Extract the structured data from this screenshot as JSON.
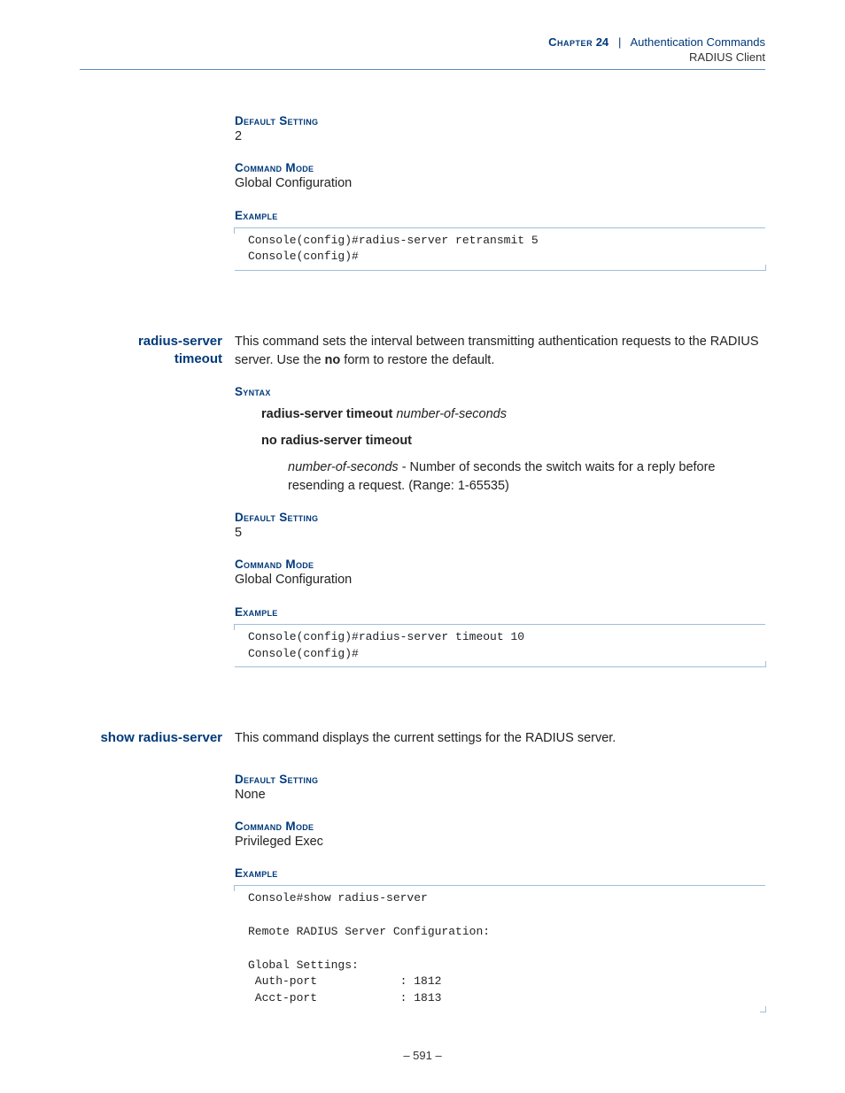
{
  "header": {
    "chapter_label": "Chapter",
    "chapter_num": "24",
    "divider": "|",
    "chapter_title": "Authentication Commands",
    "subtitle": "RADIUS Client"
  },
  "sections": {
    "prev": {
      "default_label": "Default Setting",
      "default_value": "2",
      "mode_label": "Command Mode",
      "mode_value": "Global Configuration",
      "example_label": "Example",
      "example_code": "Console(config)#radius-server retransmit 5\nConsole(config)#"
    },
    "timeout": {
      "name_line1": "radius-server",
      "name_line2": "timeout",
      "desc_prefix": "This command sets the interval between transmitting authentication requests to the RADIUS server. Use the ",
      "desc_bold": "no",
      "desc_suffix": " form to restore the default.",
      "syntax_label": "Syntax",
      "syntax1_cmd": "radius-server timeout",
      "syntax1_arg": "number-of-seconds",
      "syntax2": "no radius-server timeout",
      "param_name": "number-of-seconds",
      "param_desc": " - Number of seconds the switch waits for a reply before resending a request. (Range: 1-65535)",
      "default_label": "Default Setting",
      "default_value": "5",
      "mode_label": "Command Mode",
      "mode_value": "Global Configuration",
      "example_label": "Example",
      "example_code": "Console(config)#radius-server timeout 10\nConsole(config)#"
    },
    "show": {
      "name": "show radius-server",
      "desc": "This command displays the current settings for the RADIUS server.",
      "default_label": "Default Setting",
      "default_value": "None",
      "mode_label": "Command Mode",
      "mode_value": "Privileged Exec",
      "example_label": "Example",
      "example_code": "Console#show radius-server\n\nRemote RADIUS Server Configuration:\n\nGlobal Settings:\n Auth-port            : 1812\n Acct-port            : 1813"
    }
  },
  "page_num": "– 591 –"
}
